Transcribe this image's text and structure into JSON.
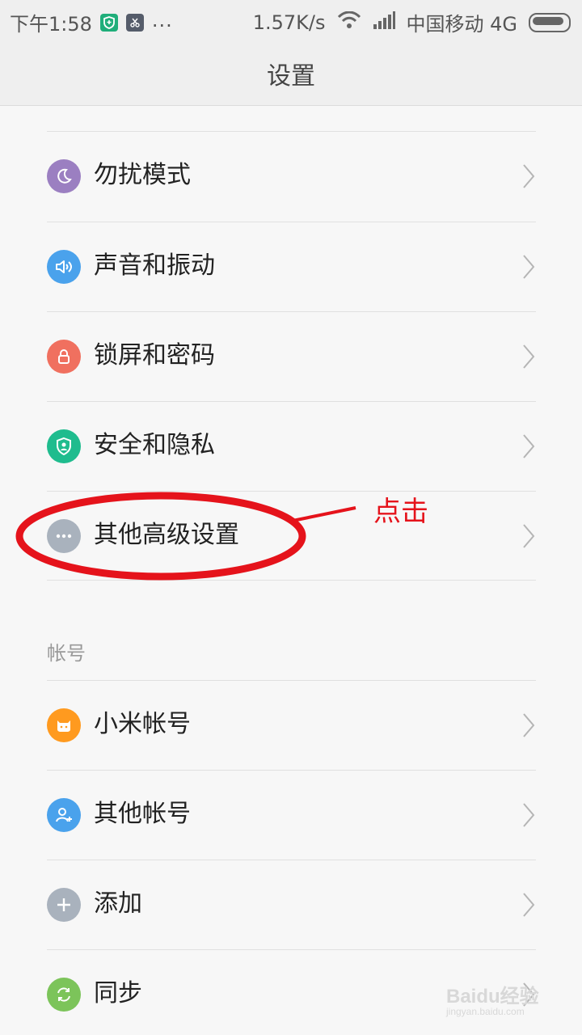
{
  "status_bar": {
    "time": "下午1:58",
    "dots": "...",
    "speed": "1.57K/s",
    "carrier": "中国移动 4G",
    "icons": [
      "shield-app-icon",
      "scissors-app-icon",
      "wifi-icon",
      "signal-icon",
      "battery-icon"
    ]
  },
  "header": {
    "title": "设置"
  },
  "settings": [
    {
      "label": "勿扰模式",
      "icon": "moon-icon",
      "color": "#9b7fc1"
    },
    {
      "label": "声音和振动",
      "icon": "speaker-icon",
      "color": "#4aa2ec"
    },
    {
      "label": "锁屏和密码",
      "icon": "lock-icon",
      "color": "#f0705f"
    },
    {
      "label": "安全和隐私",
      "icon": "shield-icon",
      "color": "#1fbc8e"
    },
    {
      "label": "其他高级设置",
      "icon": "more-icon",
      "color": "#a9b2bd"
    }
  ],
  "accounts_section": {
    "header": "帐号",
    "items": [
      {
        "label": "小米帐号",
        "icon": "mi-icon",
        "color": "#ff9a1f"
      },
      {
        "label": "其他帐号",
        "icon": "person-add-icon",
        "color": "#4aa2ec"
      },
      {
        "label": "添加",
        "icon": "plus-icon",
        "color": "#a9b2bd"
      },
      {
        "label": "同步",
        "icon": "sync-icon",
        "color": "#7cc45a"
      }
    ]
  },
  "annotation": {
    "text": "点击",
    "color": "#e5131b"
  },
  "watermark": {
    "brand": "Baidu",
    "suffix": "经验",
    "url": "jingyan.baidu.com"
  }
}
